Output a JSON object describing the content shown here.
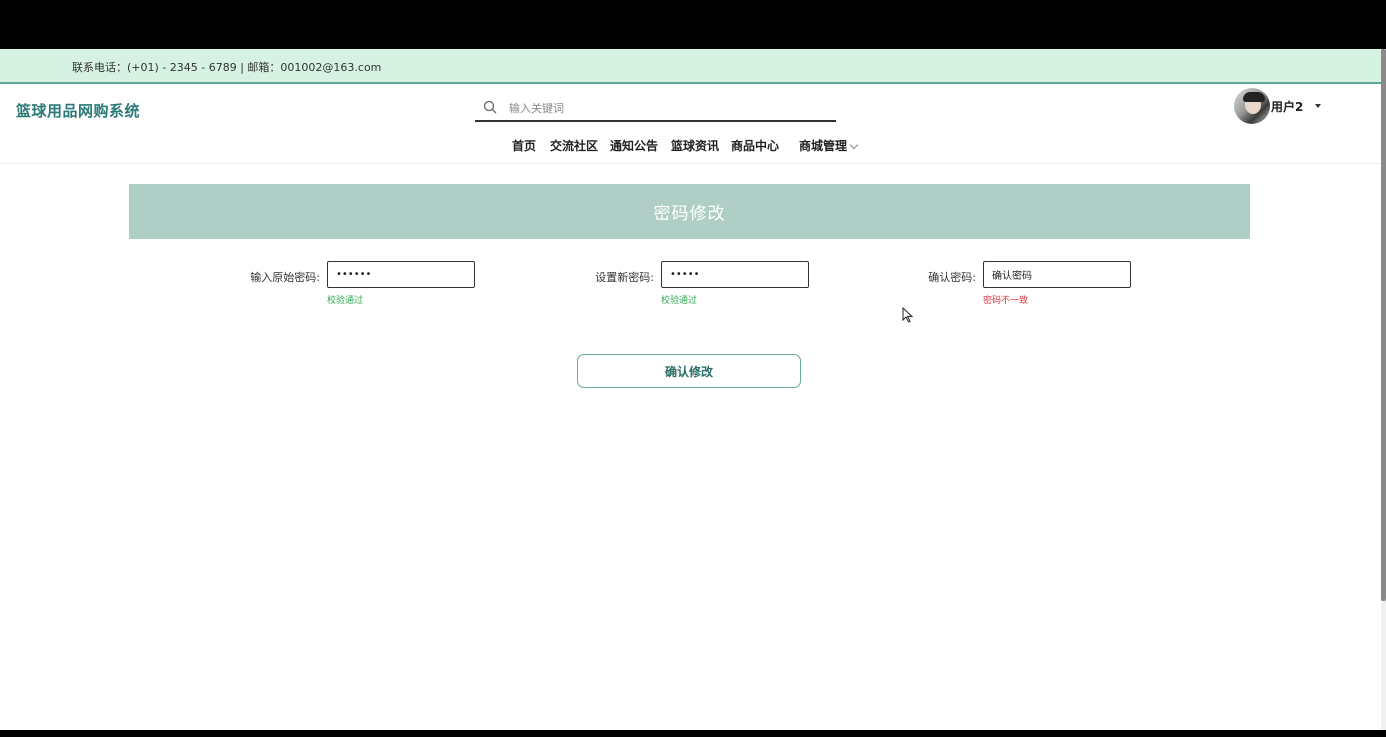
{
  "topbar": {
    "contact": "联系电话：(+01) - 2345 - 6789 | 邮箱：001002@163.com"
  },
  "header": {
    "brand": "篮球用品网购系统",
    "search": {
      "placeholder": "输入关键词",
      "icon": "search-icon"
    },
    "user": {
      "name": "用户2",
      "icon": "caret-down-icon"
    }
  },
  "nav": {
    "items": [
      {
        "label": "首页"
      },
      {
        "label": "交流社区"
      },
      {
        "label": "通知公告"
      },
      {
        "label": "篮球资讯"
      },
      {
        "label": "商品中心"
      },
      {
        "label": "商城管理",
        "icon": "chevron-down-icon"
      }
    ]
  },
  "page": {
    "title": "密码修改",
    "fields": [
      {
        "label": "输入原始密码:",
        "value": "••••••",
        "message": "校验通过",
        "status": "ok"
      },
      {
        "label": "设置新密码:",
        "value": "•••••",
        "message": "校验通过",
        "status": "ok"
      },
      {
        "label": "确认密码:",
        "value": "确认密码",
        "message": "密码不一致",
        "status": "error"
      }
    ],
    "submit_label": "确认修改"
  },
  "colors": {
    "topbar_bg": "#d6f2e2",
    "brand": "#2a7a78",
    "banner_bg": "#afcfc6",
    "ok": "#34a853",
    "error": "#d9363e"
  }
}
